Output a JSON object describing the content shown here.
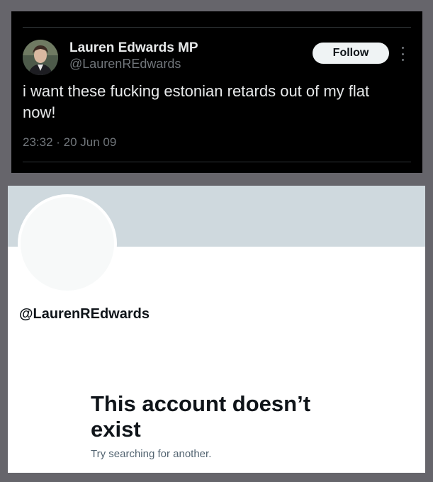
{
  "tweet": {
    "author": {
      "display_name": "Lauren Edwards MP",
      "handle": "@LaurenREdwards",
      "avatar_icon": "user-photo-avatar"
    },
    "follow_label": "Follow",
    "more_icon": "more-vertical-icon",
    "text": "i want these fucking estonian retards out of my flat now!",
    "timestamp": "23:32 · 20 Jun 09"
  },
  "profile": {
    "handle": "@LaurenREdwards",
    "banner_color": "#cfd9de",
    "empty_state": {
      "title": "This account doesn’t exist",
      "subtitle": "Try searching for another."
    }
  },
  "colors": {
    "tweet_background": "#000000",
    "follow_button_bg": "#eff3f4",
    "secondary_text": "#71767b",
    "page_background": "#66656b"
  }
}
